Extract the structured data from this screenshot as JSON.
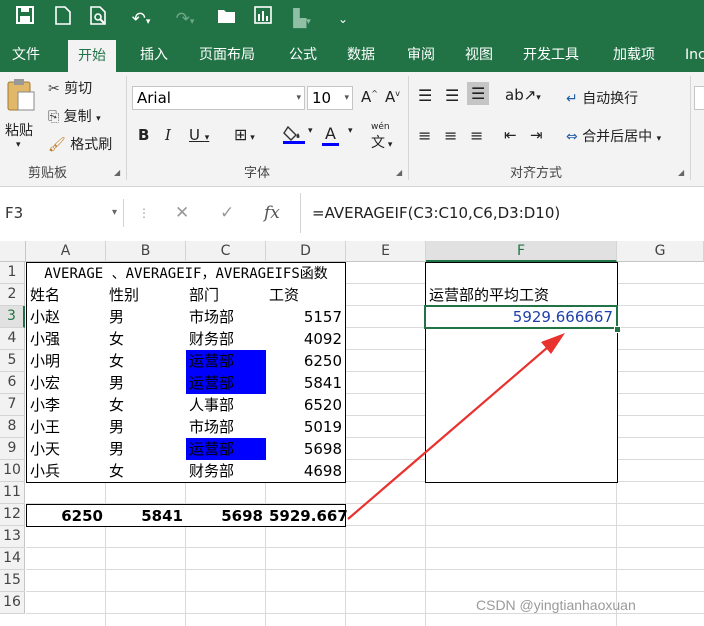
{
  "ribbon_tabs": [
    "文件",
    "开始",
    "插入",
    "页面布局",
    "公式",
    "数据",
    "审阅",
    "视图",
    "开发工具",
    "加载项",
    "Inc"
  ],
  "clipboard": {
    "paste": "粘贴",
    "cut": "剪切",
    "copy": "复制",
    "format_painter": "格式刷",
    "group": "剪贴板"
  },
  "font": {
    "name": "Arial",
    "size": "10",
    "group": "字体",
    "bold": "B",
    "italic": "I",
    "underline": "U",
    "wen": "wén"
  },
  "align": {
    "wrap": "自动换行",
    "merge": "合并后居中",
    "group": "对齐方式"
  },
  "formula_bar": {
    "name_box": "F3",
    "formula": "=AVERAGEIF(C3:C10,C6,D3:D10)"
  },
  "columns": [
    "A",
    "B",
    "C",
    "D",
    "E",
    "F",
    "G"
  ],
  "rows": [
    "1",
    "2",
    "3",
    "4",
    "5",
    "6",
    "7",
    "8",
    "9",
    "10",
    "11",
    "12",
    "13",
    "14",
    "15",
    "16"
  ],
  "sheet": {
    "title": "AVERAGE 、AVERAGEIF，AVERAGEIFS函数",
    "headers": [
      "姓名",
      "性别",
      "部门",
      "工资"
    ],
    "data": [
      [
        "小赵",
        "男",
        "市场部",
        "5157"
      ],
      [
        "小强",
        "女",
        "财务部",
        "4092"
      ],
      [
        "小明",
        "女",
        "运营部",
        "6250"
      ],
      [
        "小宏",
        "男",
        "运营部",
        "5841"
      ],
      [
        "小李",
        "女",
        "人事部",
        "6520"
      ],
      [
        "小王",
        "男",
        "市场部",
        "5019"
      ],
      [
        "小天",
        "男",
        "运营部",
        "5698"
      ],
      [
        "小兵",
        "女",
        "财务部",
        "4698"
      ]
    ],
    "summary": [
      "6250",
      "5841",
      "5698",
      "5929.667"
    ],
    "f_label": "运营部的平均工资",
    "f_value": "5929.666667"
  },
  "watermark": "CSDN @yingtianhaoxuan",
  "colors": {
    "excel_green": "#217346",
    "highlight": "#0000ff",
    "arrow": "#e8322e",
    "result_text": "#1f3faa"
  }
}
